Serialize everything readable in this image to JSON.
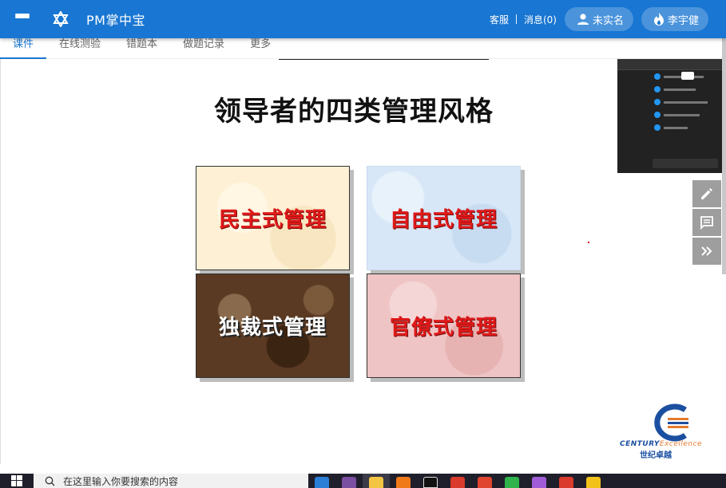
{
  "app": {
    "title": "PM掌中宝",
    "menu_icon": "menu-icon",
    "logo_icon": "star-of-david-icon"
  },
  "header": {
    "service_label": "客服",
    "messages_label": "消息(0)",
    "user_status_label": "未实名",
    "user_name_label": "李宇健",
    "accent_color": "#1976d2"
  },
  "tabs": [
    {
      "label": "课件",
      "active": true
    },
    {
      "label": "在线测验",
      "active": false
    },
    {
      "label": "错题本",
      "active": false
    },
    {
      "label": "做题记录",
      "active": false
    },
    {
      "label": "更多",
      "active": false
    }
  ],
  "slide": {
    "title": "领导者的四类管理风格",
    "boxes": [
      {
        "label": "民主式管理"
      },
      {
        "label": "自由式管理"
      },
      {
        "label": "独裁式管理"
      },
      {
        "label": "官僚式管理"
      }
    ],
    "brand_en_1": "CENTURY",
    "brand_en_2": "Excellence",
    "brand_cn": "世纪卓越"
  },
  "tools": [
    {
      "icon": "pencil-icon"
    },
    {
      "icon": "comment-icon"
    },
    {
      "icon": "double-chevron-right-icon"
    }
  ],
  "taskbar": {
    "search_placeholder": "在这里输入你要搜索的内容"
  }
}
